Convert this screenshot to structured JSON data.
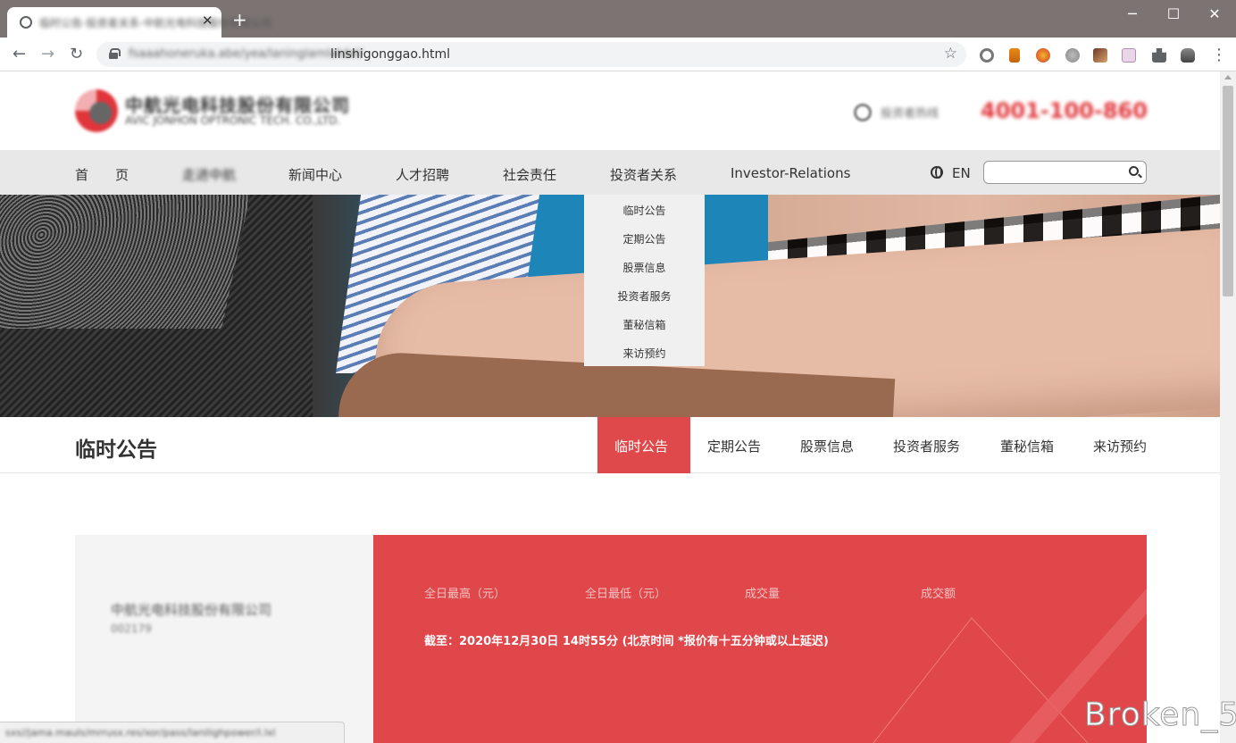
{
  "browser": {
    "tab_title": "临时公告-投资者关系-中航光电科技股份有限公司",
    "close_tab": "✕",
    "new_tab": "+",
    "url_prefix": "fsaaahoneruka.abe/yea/laninglamlatdel/",
    "url_path": "linshigonggao.html",
    "back": "←",
    "forward": "→",
    "reload": "↻",
    "star": "☆",
    "menu": "⋮",
    "minimize": "─",
    "maximize": "☐",
    "close_window": "✕",
    "status_url": "sxs//jama.mauls/mrrusx.res/xor/pass/lanilighpower/i.lxl"
  },
  "header": {
    "logo_cn": "中航光电科技股份有限公司",
    "logo_en": "AVIC JONHON OPTRONIC TECH. CO.,LTD.",
    "hotline_label": "投资者热线",
    "hotline_number": "4001-100-860"
  },
  "nav": {
    "items": [
      "首　　页",
      "走进中航",
      "新闻中心",
      "人才招聘",
      "社会责任",
      "投资者关系",
      "Investor-Relations"
    ],
    "lang": "EN",
    "search_placeholder": ""
  },
  "dropdown": {
    "items": [
      "临时公告",
      "定期公告",
      "股票信息",
      "投资者服务",
      "董秘信箱",
      "来访预约"
    ]
  },
  "subnav": {
    "title": "临时公告",
    "tabs": [
      "临时公告",
      "定期公告",
      "股票信息",
      "投资者服务",
      "董秘信箱",
      "来访预约"
    ],
    "active_index": 0
  },
  "stock": {
    "name": "中航光电科技股份有限公司",
    "code": "002179",
    "headers": [
      "全日最高（元）",
      "全日最低（元）",
      "成交量",
      "成交额"
    ],
    "as_of": "截至：2020年12月30日 14时55分 (北京时间 *报价有十五分钟或以上延迟)"
  },
  "watermark": "Broken_5",
  "colors": {
    "accent": "#e0474a",
    "nav_bg": "#e8e8e8",
    "dropdown_bg": "#f0f0f0"
  }
}
